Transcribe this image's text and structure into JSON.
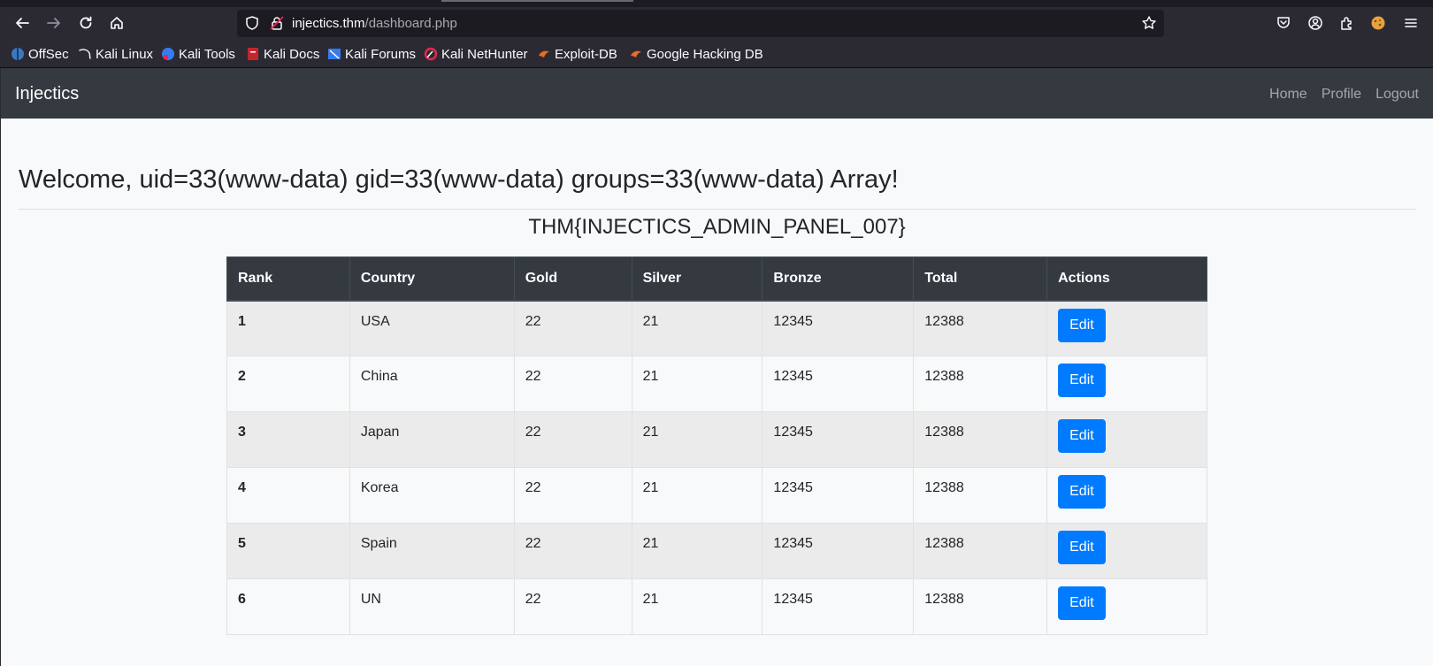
{
  "browser": {
    "url_host": "injectics.thm",
    "url_path": "/dashboard.php",
    "bookmarks": [
      {
        "label": "OffSec",
        "icon": "offsec-icon"
      },
      {
        "label": "Kali Linux",
        "icon": "kali-dragon-icon"
      },
      {
        "label": "Kali Tools",
        "icon": "kali-tools-icon"
      },
      {
        "label": "Kali Docs",
        "icon": "kali-docs-icon"
      },
      {
        "label": "Kali Forums",
        "icon": "kali-forums-icon"
      },
      {
        "label": "Kali NetHunter",
        "icon": "kali-nethunter-icon"
      },
      {
        "label": "Exploit-DB",
        "icon": "exploit-db-icon"
      },
      {
        "label": "Google Hacking DB",
        "icon": "ghdb-icon"
      }
    ]
  },
  "navbar": {
    "brand": "Injectics",
    "links": [
      "Home",
      "Profile",
      "Logout"
    ]
  },
  "main": {
    "welcome": "Welcome, uid=33(www-data) gid=33(www-data) groups=33(www-data) Array!",
    "flag": "THM{INJECTICS_ADMIN_PANEL_007}"
  },
  "table": {
    "headers": [
      "Rank",
      "Country",
      "Gold",
      "Silver",
      "Bronze",
      "Total",
      "Actions"
    ],
    "rows": [
      {
        "rank": "1",
        "country": "USA",
        "gold": "22",
        "silver": "21",
        "bronze": "12345",
        "total": "12388",
        "action": "Edit"
      },
      {
        "rank": "2",
        "country": "China",
        "gold": "22",
        "silver": "21",
        "bronze": "12345",
        "total": "12388",
        "action": "Edit"
      },
      {
        "rank": "3",
        "country": "Japan",
        "gold": "22",
        "silver": "21",
        "bronze": "12345",
        "total": "12388",
        "action": "Edit"
      },
      {
        "rank": "4",
        "country": "Korea",
        "gold": "22",
        "silver": "21",
        "bronze": "12345",
        "total": "12388",
        "action": "Edit"
      },
      {
        "rank": "5",
        "country": "Spain",
        "gold": "22",
        "silver": "21",
        "bronze": "12345",
        "total": "12388",
        "action": "Edit"
      },
      {
        "rank": "6",
        "country": "UN",
        "gold": "22",
        "silver": "21",
        "bronze": "12345",
        "total": "12388",
        "action": "Edit"
      }
    ]
  },
  "colors": {
    "navbar_bg": "#343a40",
    "primary_button": "#007bff",
    "page_bg": "#f8f9fa"
  }
}
